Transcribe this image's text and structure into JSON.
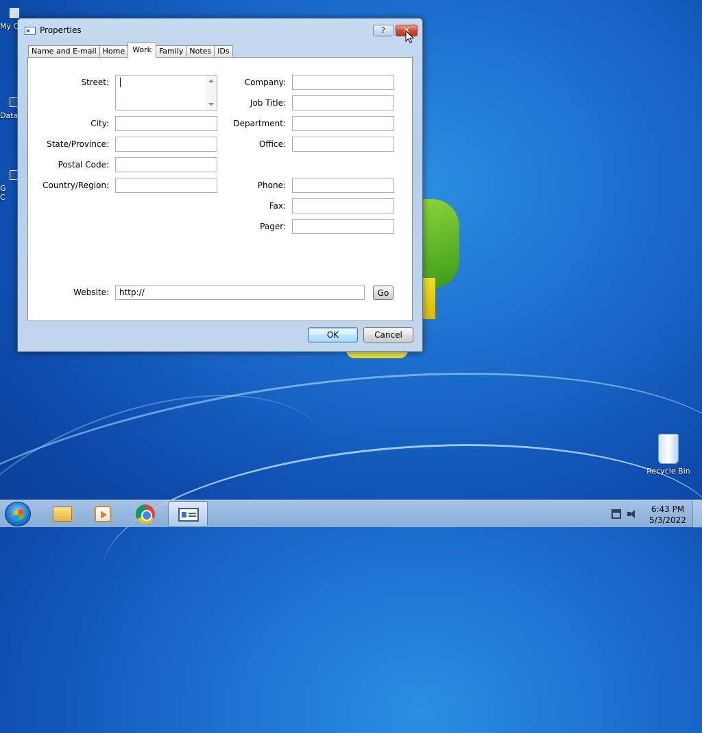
{
  "desktop": {
    "icons_left": [
      {
        "label": "My C"
      },
      {
        "label": "Data"
      },
      {
        "label": "G\nC"
      }
    ],
    "recycle_bin_label": "Recycle Bin"
  },
  "dialog": {
    "title": "Properties",
    "help_label": "?",
    "close_label": "✕",
    "tabs": [
      {
        "label": "Name and E-mail"
      },
      {
        "label": "Home"
      },
      {
        "label": "Work"
      },
      {
        "label": "Family"
      },
      {
        "label": "Notes"
      },
      {
        "label": "IDs"
      }
    ],
    "active_tab": "Work",
    "fields": {
      "street": {
        "label": "Street:",
        "value": ""
      },
      "city": {
        "label": "City:",
        "value": ""
      },
      "state": {
        "label": "State/Province:",
        "value": ""
      },
      "postal": {
        "label": "Postal Code:",
        "value": ""
      },
      "country": {
        "label": "Country/Region:",
        "value": ""
      },
      "company": {
        "label": "Company:",
        "value": ""
      },
      "job_title": {
        "label": "Job Title:",
        "value": ""
      },
      "department": {
        "label": "Department:",
        "value": ""
      },
      "office": {
        "label": "Office:",
        "value": ""
      },
      "phone": {
        "label": "Phone:",
        "value": ""
      },
      "fax": {
        "label": "Fax:",
        "value": ""
      },
      "pager": {
        "label": "Pager:",
        "value": ""
      },
      "website": {
        "label": "Website:",
        "value": "http://"
      }
    },
    "go_label": "Go",
    "ok_label": "OK",
    "cancel_label": "Cancel"
  },
  "taskbar": {
    "clock_time": "6:43 PM",
    "clock_date": "5/3/2022",
    "items": [
      "windows-explorer",
      "windows-media-player",
      "google-chrome",
      "contacts-properties"
    ]
  }
}
